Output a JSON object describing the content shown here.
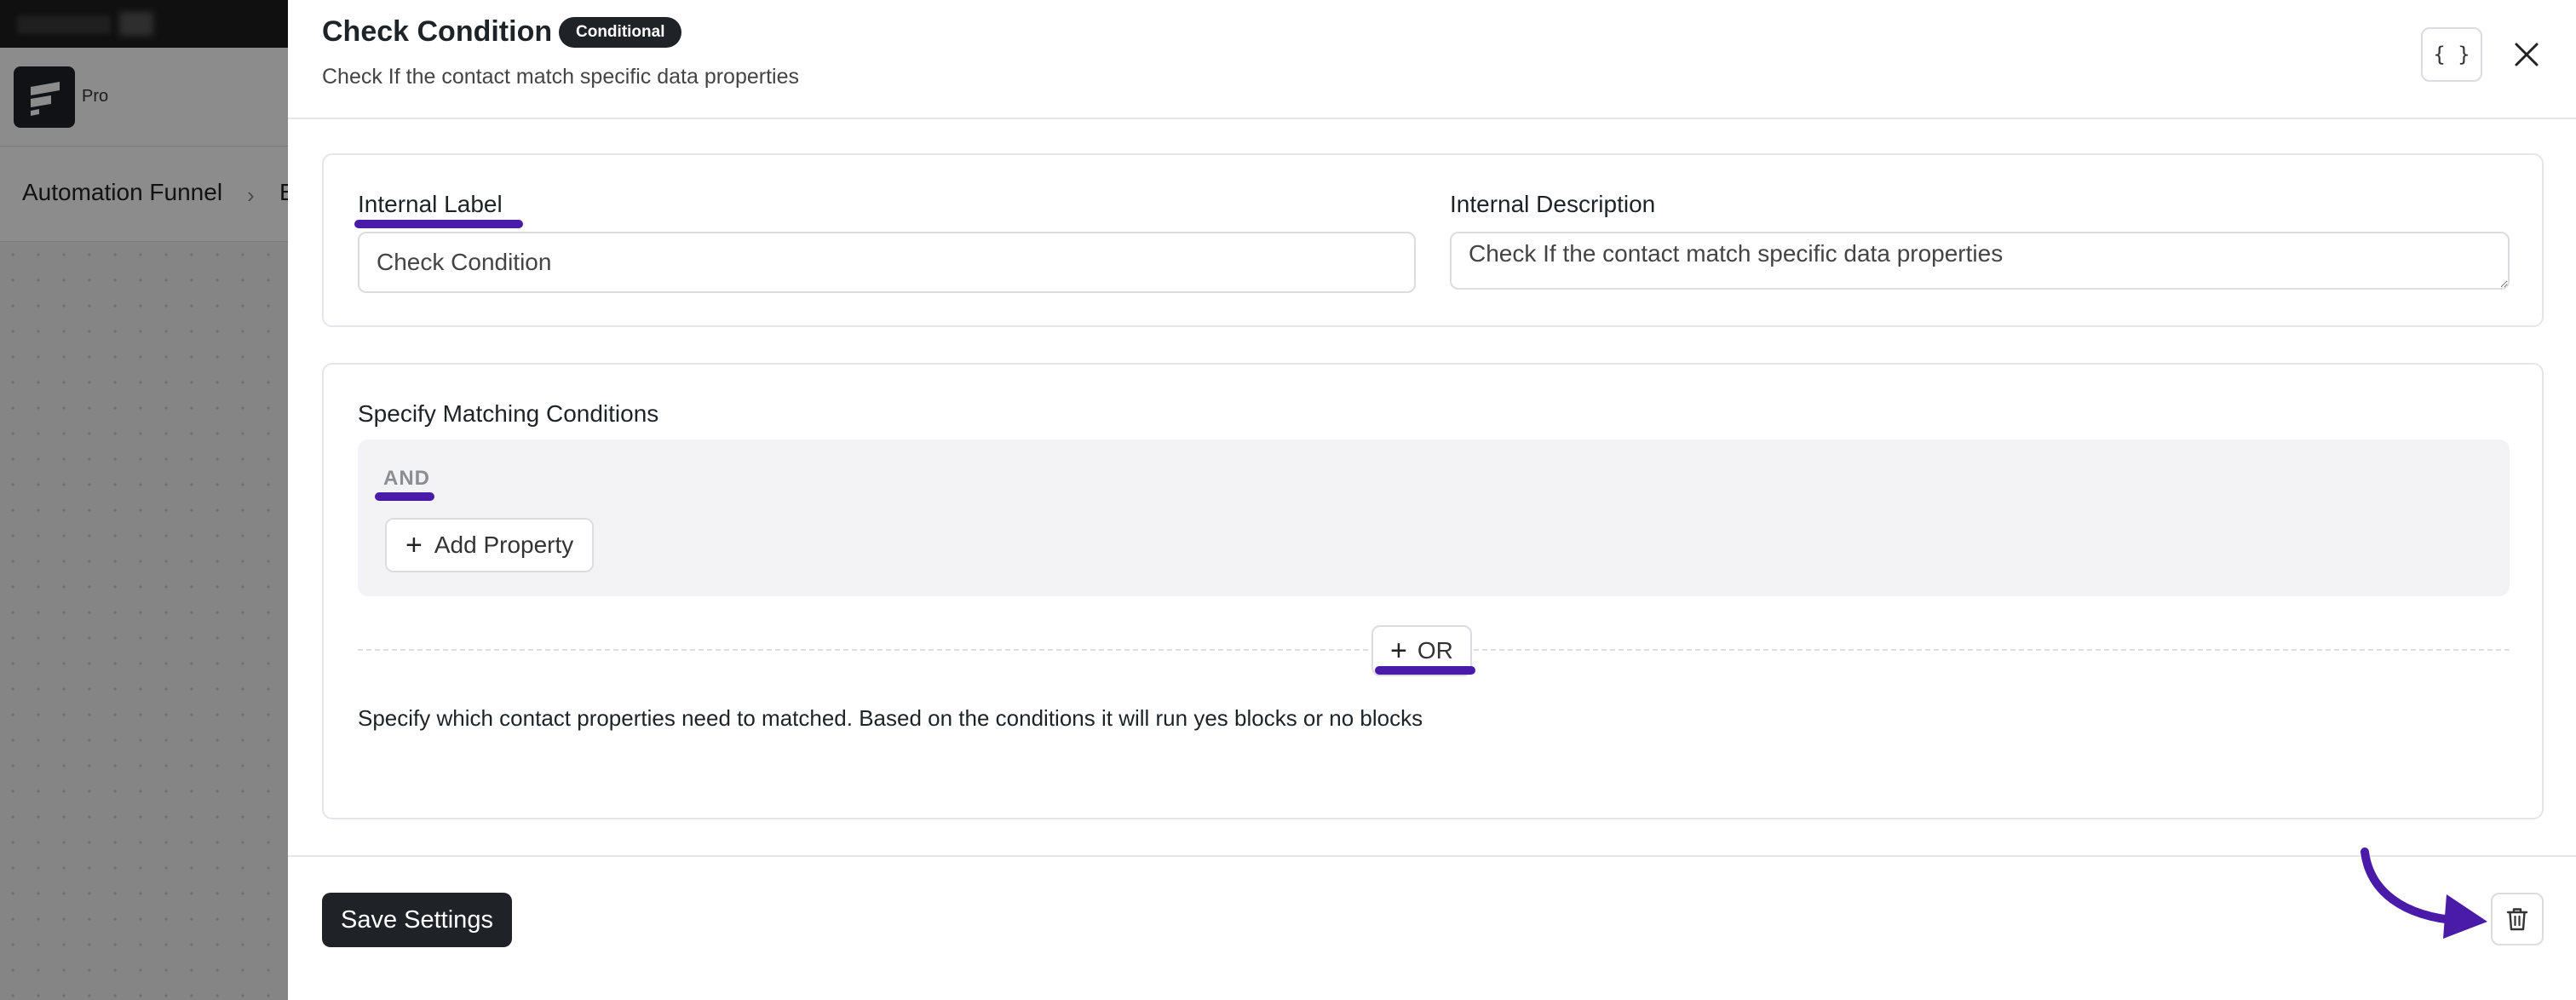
{
  "background": {
    "logo_label": "Pro",
    "breadcrumb_root": "Automation Funnel",
    "breadcrumb_next": "E"
  },
  "drawer": {
    "title": "Check Condition",
    "badge": "Conditional",
    "subtitle": "Check If the contact match specific data properties",
    "json_button": "{ }",
    "fields": {
      "internal_label": {
        "label": "Internal Label",
        "value": "Check Condition"
      },
      "internal_description": {
        "label": "Internal Description",
        "value": "Check If the contact match specific data properties"
      }
    },
    "conditions": {
      "title": "Specify Matching Conditions",
      "group_operator": "AND",
      "add_property_label": "Add Property",
      "or_button_label": "OR",
      "helper_text": "Specify which contact properties need to matched. Based on the conditions it will run yes blocks or no blocks"
    },
    "footer": {
      "save_label": "Save Settings"
    }
  },
  "colors": {
    "annotation": "#4a1aa8",
    "primary_dark": "#1f2227",
    "border": "#dcdce1"
  },
  "icons": [
    "close-icon",
    "code-braces-icon",
    "plus-icon",
    "trash-icon",
    "arrow-annotation-icon",
    "app-logo-icon",
    "chevron-right-icon"
  ]
}
